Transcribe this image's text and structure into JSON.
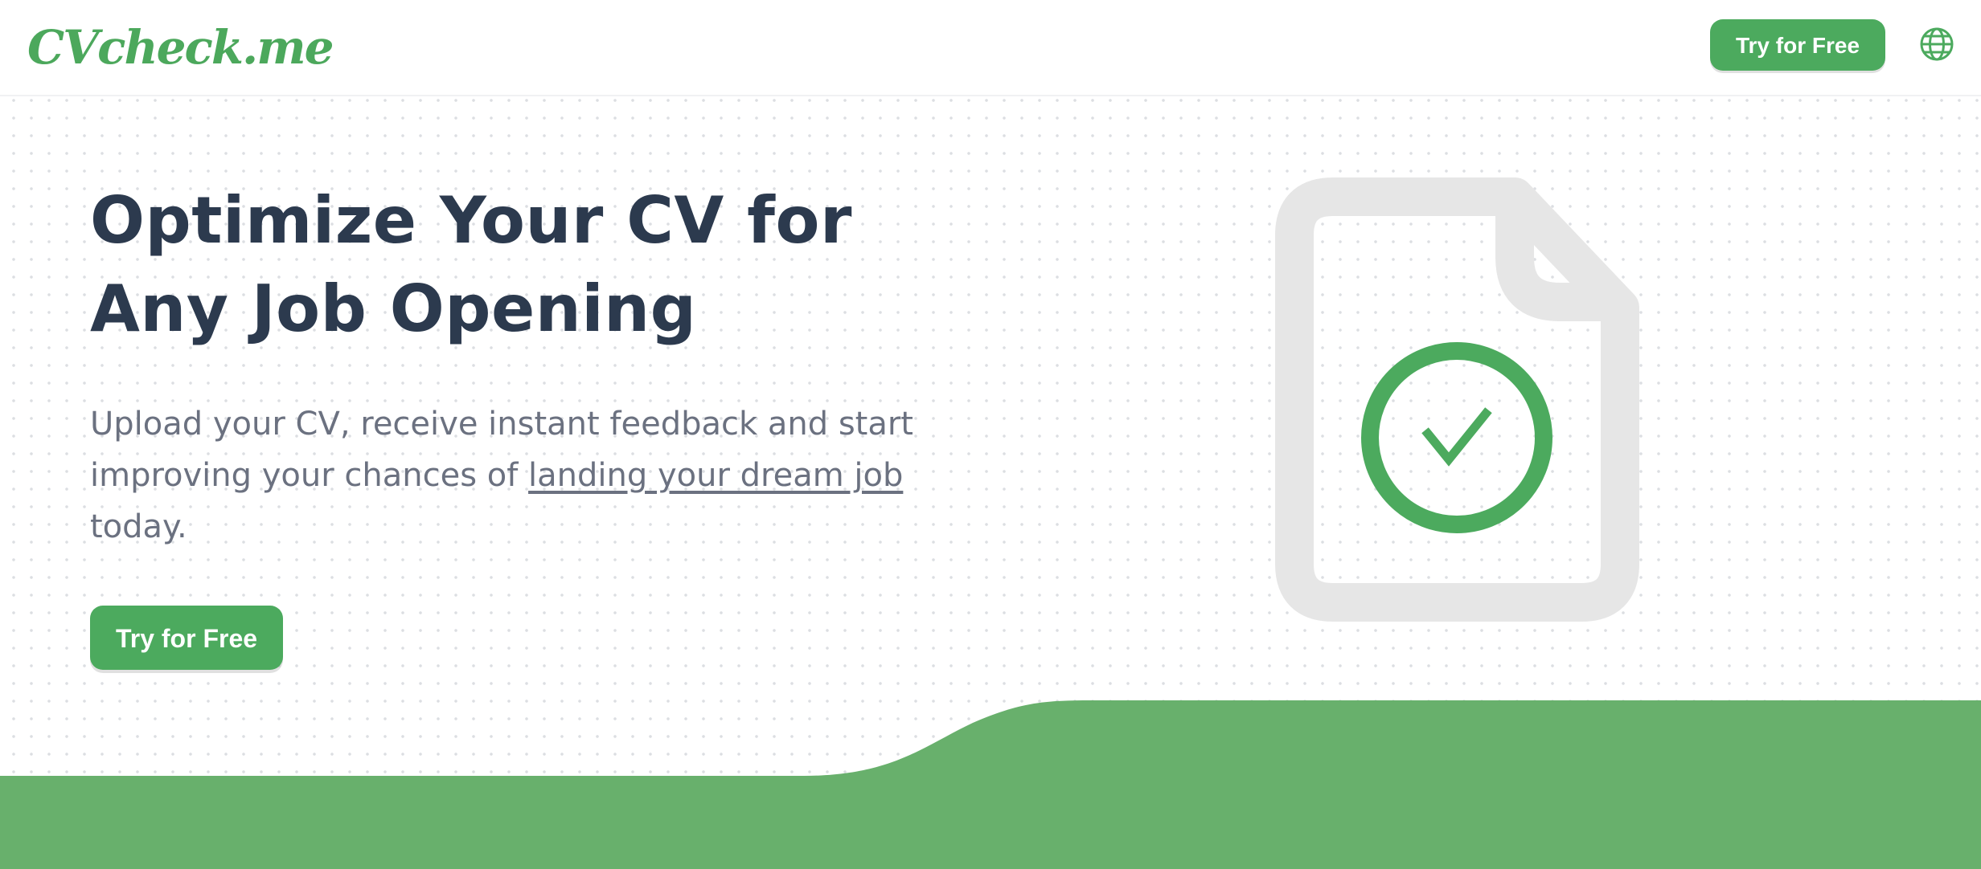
{
  "header": {
    "logo_text": "CVcheck.me",
    "cta_label": "Try for Free",
    "language_icon": "globe-icon"
  },
  "hero": {
    "title_line1": "Optimize Your CV for",
    "title_line2": "Any Job Opening",
    "subtitle_before": "Upload your CV, receive instant feedback and start improving your chances of ",
    "subtitle_link": "landing your dream job",
    "subtitle_after": " today.",
    "cta_label": "Try for Free",
    "illustration_icon": "document-check-icon"
  },
  "colors": {
    "brand_green": "#4caa5e",
    "wave_green": "#68b06c",
    "heading": "#2c3a4e",
    "body_text": "#6b7180",
    "document_gray": "#e6e6e6"
  }
}
